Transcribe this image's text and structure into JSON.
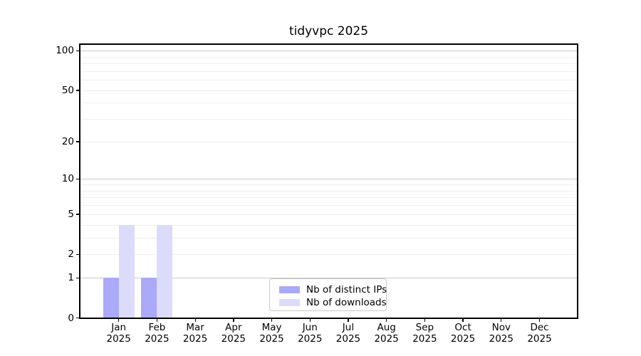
{
  "title": "tidyvpc 2025",
  "legend": {
    "items": [
      {
        "label": "Nb of distinct IPs",
        "color": "#aaaaf8"
      },
      {
        "label": "Nb of downloads",
        "color": "#dcdcfa"
      }
    ]
  },
  "colors": {
    "major_grid": "#c9c9c9",
    "minor_grid": "#efefef",
    "axis": "#000000",
    "bar_distinct_ips": "#aaaaf8",
    "bar_downloads": "#dcdcfa"
  },
  "chart_data": {
    "type": "bar",
    "title": "tidyvpc 2025",
    "x": [
      "Jan",
      "Feb",
      "Mar",
      "Apr",
      "May",
      "Jun",
      "Jul",
      "Aug",
      "Sep",
      "Oct",
      "Nov",
      "Dec"
    ],
    "year": "2025",
    "series": [
      {
        "name": "Nb of distinct IPs",
        "color": "#aaaaf8",
        "values": [
          1,
          1,
          0,
          0,
          0,
          0,
          0,
          0,
          0,
          0,
          0,
          0
        ]
      },
      {
        "name": "Nb of downloads",
        "color": "#dcdcfa",
        "values": [
          4,
          4,
          0,
          0,
          0,
          0,
          0,
          0,
          0,
          0,
          0,
          0
        ]
      }
    ],
    "yscale": "log1p",
    "ylim": [
      0,
      112
    ],
    "y_tick_values": [
      0,
      1,
      2,
      5,
      10,
      20,
      50,
      100
    ],
    "y_major_gridlines": [
      1,
      10,
      100
    ],
    "y_minor_gridlines": [
      2,
      3,
      4,
      5,
      6,
      7,
      8,
      9,
      20,
      30,
      40,
      50,
      60,
      70,
      80,
      90
    ],
    "grid": true,
    "legend_position": "bottom-center-inside",
    "xlabel": "",
    "ylabel": ""
  }
}
